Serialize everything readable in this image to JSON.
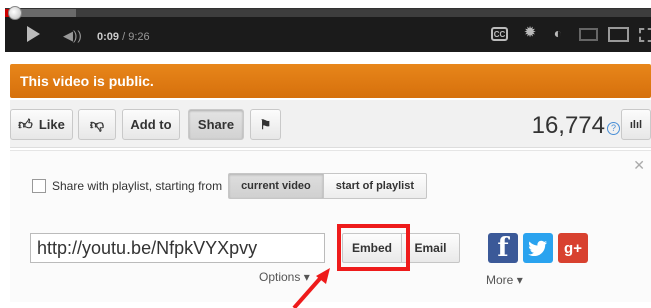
{
  "player": {
    "current_time": "0:09",
    "duration": "/ 9:26",
    "progress_fraction": 0.016,
    "loaded_fraction": 0.11,
    "icons": [
      "play-icon",
      "volume-icon",
      "captions-icon",
      "gear-icon",
      "watch-later-icon",
      "small-player-icon",
      "large-player-icon",
      "fullscreen-icon"
    ],
    "cc_label": "CC"
  },
  "banner": {
    "text": "This video is public."
  },
  "toolbar": {
    "like_label": "Like",
    "add_to_label": "Add to",
    "share_label": "Share",
    "view_count": "16,774",
    "help_glyph": "?",
    "stats_glyph": "ılıl"
  },
  "share_panel": {
    "playlist_label": "Share with playlist, starting from",
    "playlist_options": [
      "current video",
      "start of playlist"
    ],
    "selected_option": "current video",
    "url_value": "http://youtu.be/NfpkVYXpvy",
    "options_label": "Options",
    "embed_label": "Embed",
    "email_label": "Email",
    "more_label": "More",
    "social": {
      "facebook": "f",
      "gplus": "g+"
    }
  },
  "colors": {
    "banner": "#e07b14",
    "highlight": "#ee1b1b",
    "facebook": "#3b5998",
    "twitter": "#2aa3ef",
    "gplus": "#d8412f",
    "progress": "#cc0000"
  }
}
